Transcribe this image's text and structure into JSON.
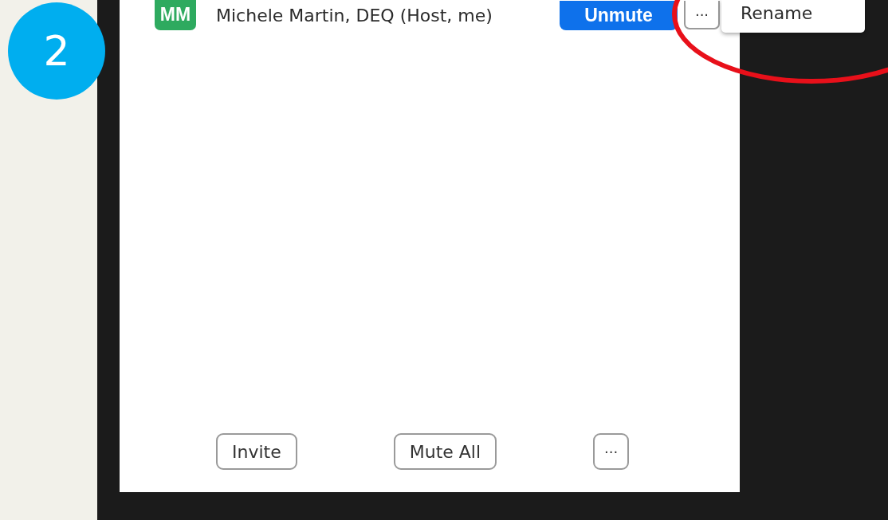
{
  "step_badge": "2",
  "participant": {
    "initials": "MM",
    "name": "Michele Martin, DEQ (Host, me)",
    "unmute_button": "Unmute",
    "more_button": "···"
  },
  "menu": {
    "items": [
      {
        "label": "Rename"
      }
    ]
  },
  "annotation": {
    "kind": "ellipse"
  },
  "footer_buttons": [
    {
      "label": "Invite"
    },
    {
      "label": "Mute All"
    },
    {
      "label": "···"
    }
  ]
}
